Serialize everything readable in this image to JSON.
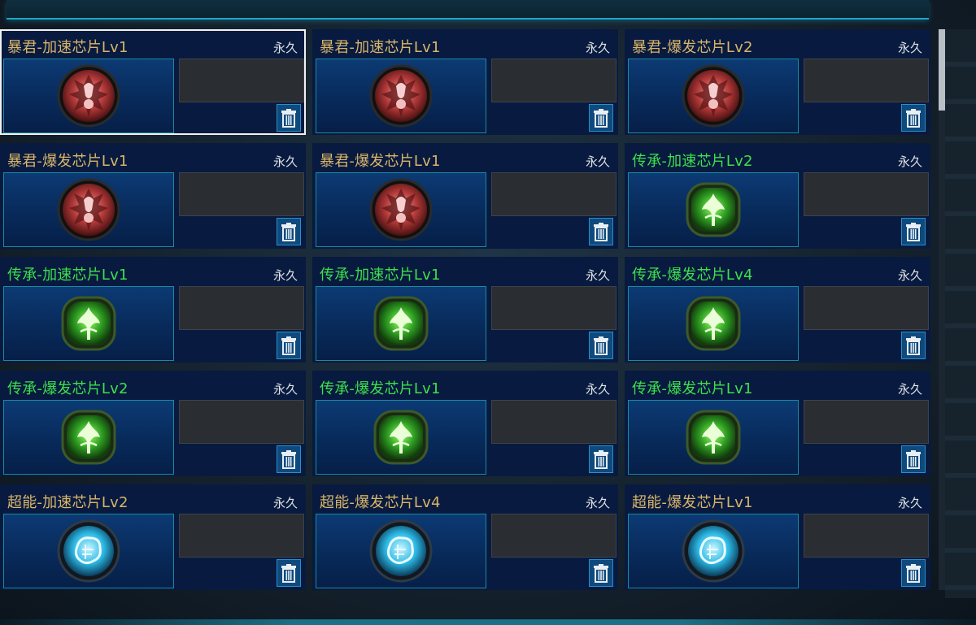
{
  "cards": [
    {
      "title": "暴君-加速芯片Lv1",
      "duration": "永久",
      "quality": "tyrant",
      "icon": "tyrant-chip-icon",
      "selected": true
    },
    {
      "title": "暴君-加速芯片Lv1",
      "duration": "永久",
      "quality": "tyrant",
      "icon": "tyrant-chip-icon",
      "selected": false
    },
    {
      "title": "暴君-爆发芯片Lv2",
      "duration": "永久",
      "quality": "tyrant",
      "icon": "tyrant-chip-icon",
      "selected": false
    },
    {
      "title": "暴君-爆发芯片Lv1",
      "duration": "永久",
      "quality": "tyrant",
      "icon": "tyrant-chip-icon",
      "selected": false
    },
    {
      "title": "暴君-爆发芯片Lv1",
      "duration": "永久",
      "quality": "tyrant",
      "icon": "tyrant-chip-icon",
      "selected": false
    },
    {
      "title": "传承-加速芯片Lv2",
      "duration": "永久",
      "quality": "legacy",
      "icon": "legacy-chip-icon",
      "selected": false
    },
    {
      "title": "传承-加速芯片Lv1",
      "duration": "永久",
      "quality": "legacy",
      "icon": "legacy-chip-icon",
      "selected": false
    },
    {
      "title": "传承-加速芯片Lv1",
      "duration": "永久",
      "quality": "legacy",
      "icon": "legacy-chip-icon",
      "selected": false
    },
    {
      "title": "传承-爆发芯片Lv4",
      "duration": "永久",
      "quality": "legacy",
      "icon": "legacy-chip-icon",
      "selected": false
    },
    {
      "title": "传承-爆发芯片Lv2",
      "duration": "永久",
      "quality": "legacy",
      "icon": "legacy-chip-icon",
      "selected": false
    },
    {
      "title": "传承-爆发芯片Lv1",
      "duration": "永久",
      "quality": "legacy",
      "icon": "legacy-chip-icon",
      "selected": false
    },
    {
      "title": "传承-爆发芯片Lv1",
      "duration": "永久",
      "quality": "legacy",
      "icon": "legacy-chip-icon",
      "selected": false
    },
    {
      "title": "超能-加速芯片Lv2",
      "duration": "永久",
      "quality": "psi",
      "icon": "psi-chip-icon",
      "selected": false
    },
    {
      "title": "超能-爆发芯片Lv4",
      "duration": "永久",
      "quality": "psi",
      "icon": "psi-chip-icon",
      "selected": false
    },
    {
      "title": "超能-爆发芯片Lv1",
      "duration": "永久",
      "quality": "psi",
      "icon": "psi-chip-icon",
      "selected": false
    }
  ],
  "colors": {
    "tyrant": "#d9b56a",
    "legacy": "#3ee04d",
    "psi": "#d9b56a",
    "accent": "#1ea7c8"
  }
}
